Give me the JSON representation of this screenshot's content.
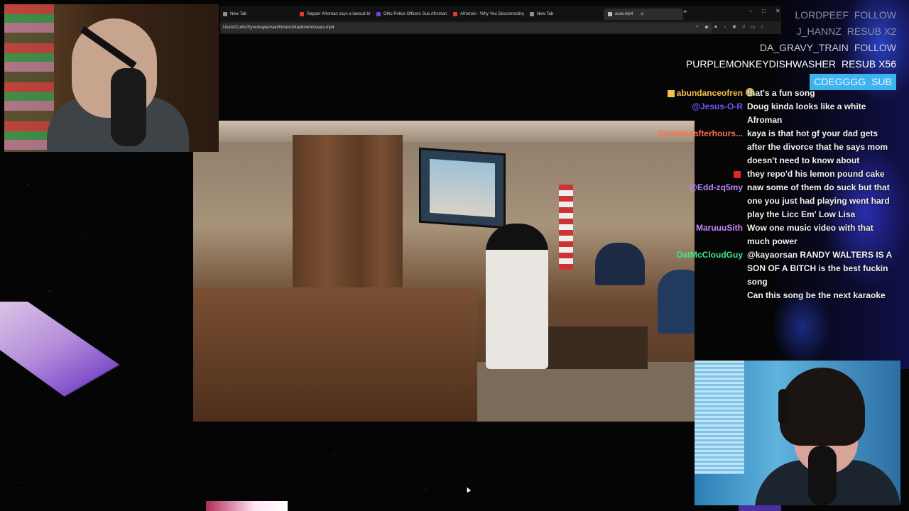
{
  "browser": {
    "tabs": [
      {
        "label": "New Tab",
        "active": false,
        "favicon_color": "#8f8f8f"
      },
      {
        "label": "Rapper Afroman says a lawsuit brou...",
        "active": false,
        "favicon_color": "#e53935"
      },
      {
        "label": "Ohio Police Officers Sue Afroman fo...",
        "active": false,
        "favicon_color": "#7b3fe4"
      },
      {
        "label": "Afroman - Why You Disconnecting M...",
        "active": false,
        "favicon_color": "#e53935"
      },
      {
        "label": "New Tab",
        "active": false,
        "favicon_color": "#8f8f8f"
      },
      {
        "label": "aura.mp4",
        "active": true,
        "favicon_color": "#bdbdbd"
      }
    ],
    "new_tab_symbol": "+",
    "window_controls": [
      "–",
      "□",
      "✕"
    ],
    "address": "Users/Curtis/Sync/kayaorsan/Notes/Attachments/aura.mp4"
  },
  "alerts": [
    {
      "name": "LORDPEEF",
      "action": "FOLLOW",
      "tone": "faded"
    },
    {
      "name": "J_HANNZ",
      "action": "RESUB X2",
      "tone": "faded"
    },
    {
      "name": "DA_GRAVY_TRAIN",
      "action": "FOLLOW",
      "tone": "mid"
    },
    {
      "name": "PURPLEMONKEYDISHWASHER",
      "action": "RESUB X56",
      "tone": "bright"
    },
    {
      "name": "CDEGGGG",
      "action": "SUB",
      "tone": "highlight"
    }
  ],
  "chat": [
    {
      "user": "abundanceofren",
      "color": "#f5c14b",
      "badge": true,
      "message": "that's a fun song"
    },
    {
      "user": "@Jesus-O-R",
      "color": "#6b5cff",
      "badge": false,
      "message": "Doug kinda looks like a white Afroman"
    },
    {
      "user": "@nathanafterhours...",
      "color": "#ff6d4a",
      "badge": false,
      "message": "kaya is that hot gf your dad gets after the divorce that he says mom doesn't need to know about"
    },
    {
      "user": "",
      "color": "#e02727",
      "badge": true,
      "message": "they repo'd his lemon pound cake"
    },
    {
      "user": "@Edd-zq5my",
      "color": "#b68cff",
      "badge": false,
      "message": "naw some of them do suck but that one you just had playing went hard"
    },
    {
      "user": "",
      "color": "#3dbb4e",
      "badge": false,
      "message": "play the Licc Em' Low Lisa"
    },
    {
      "user": "MaruuuSith",
      "color": "#c887ff",
      "badge": false,
      "message": "Wow one music video with that much power"
    },
    {
      "user": "DatMcCloudGuy",
      "color": "#3ee68a",
      "badge": false,
      "message": "@kayaorsan RANDY WALTERS IS A SON OF A BITCH is the best fuckin song"
    },
    {
      "user": "",
      "color": "#4a5cff",
      "badge": false,
      "message": "Can this song be the next karaoke"
    }
  ]
}
